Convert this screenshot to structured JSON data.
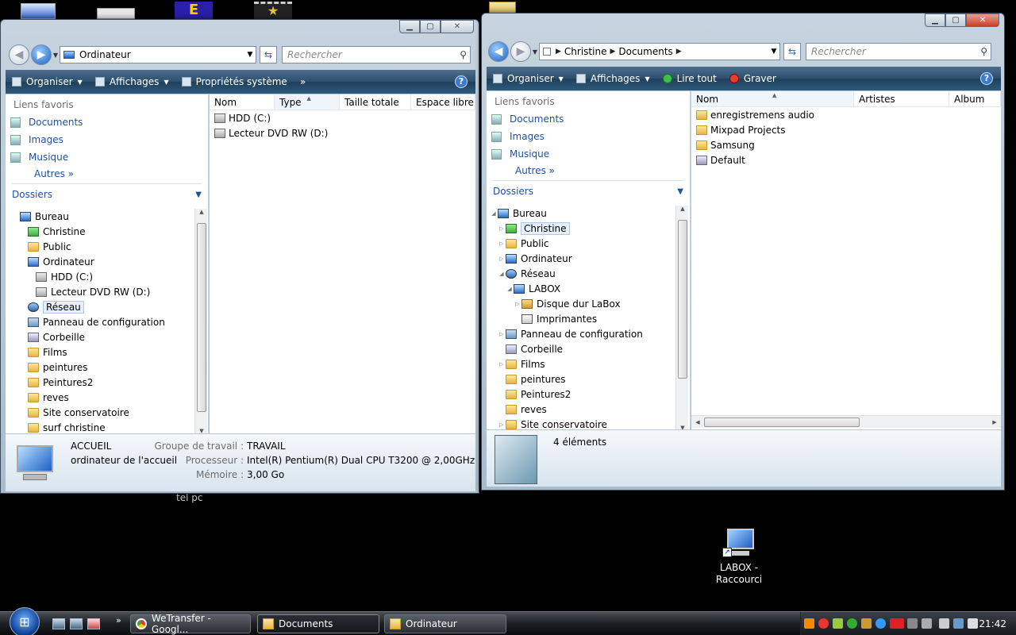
{
  "desktop": {
    "label_tel_pc": "tel pc",
    "labox_shortcut": {
      "line1": "LABOX -",
      "line2": "Raccourci"
    }
  },
  "win1": {
    "address": "Ordinateur",
    "search_placeholder": "Rechercher",
    "toolbar": {
      "organiser": "Organiser",
      "affichages": "Affichages",
      "proprietes": "Propriétés système",
      "more": "»"
    },
    "favorites_header": "Liens favoris",
    "favorites": [
      "Documents",
      "Images",
      "Musique"
    ],
    "autres": "Autres",
    "dossiers": "Dossiers",
    "tree": [
      {
        "label": "Bureau",
        "icon": "pc",
        "indent": 0,
        "exp": ""
      },
      {
        "label": "Christine",
        "icon": "user",
        "indent": 1,
        "exp": ""
      },
      {
        "label": "Public",
        "icon": "folder",
        "indent": 1,
        "exp": ""
      },
      {
        "label": "Ordinateur",
        "icon": "pc",
        "indent": 1,
        "exp": ""
      },
      {
        "label": "HDD (C:)",
        "icon": "drive",
        "indent": 2,
        "exp": ""
      },
      {
        "label": "Lecteur DVD RW (D:)",
        "icon": "drive",
        "indent": 2,
        "exp": ""
      },
      {
        "label": "Réseau",
        "icon": "net",
        "indent": 1,
        "exp": "",
        "selected": true
      },
      {
        "label": "Panneau de configuration",
        "icon": "panel",
        "indent": 1,
        "exp": ""
      },
      {
        "label": "Corbeille",
        "icon": "bin",
        "indent": 1,
        "exp": ""
      },
      {
        "label": "Films",
        "icon": "folder",
        "indent": 1,
        "exp": ""
      },
      {
        "label": "peintures",
        "icon": "folder",
        "indent": 1,
        "exp": ""
      },
      {
        "label": "Peintures2",
        "icon": "folder",
        "indent": 1,
        "exp": ""
      },
      {
        "label": "reves",
        "icon": "folder",
        "indent": 1,
        "exp": ""
      },
      {
        "label": "Site conservatoire",
        "icon": "folder",
        "indent": 1,
        "exp": ""
      },
      {
        "label": "surf christine",
        "icon": "folder",
        "indent": 1,
        "exp": ""
      }
    ],
    "columns": [
      "Nom",
      "Type",
      "Taille totale",
      "Espace libre"
    ],
    "files": [
      {
        "name": "HDD (C:)",
        "icon": "drive"
      },
      {
        "name": "Lecteur DVD RW (D:)",
        "icon": "drive"
      }
    ],
    "details": {
      "name": "ACCUEIL",
      "desc": "ordinateur de l'accueil",
      "workgroup_label": "Groupe de travail :",
      "workgroup": "TRAVAIL",
      "processor_label": "Processeur :",
      "processor": "Intel(R) Pentium(R) Dual  CPU  T3200  @ 2,00GHz",
      "memory_label": "Mémoire :",
      "memory": "3,00 Go"
    }
  },
  "win2": {
    "breadcrumb": [
      "Christine",
      "Documents"
    ],
    "search_placeholder": "Rechercher",
    "toolbar": {
      "organiser": "Organiser",
      "affichages": "Affichages",
      "lire": "Lire tout",
      "graver": "Graver"
    },
    "favorites_header": "Liens favoris",
    "favorites": [
      "Documents",
      "Images",
      "Musique"
    ],
    "autres": "Autres",
    "dossiers": "Dossiers",
    "tree": [
      {
        "label": "Bureau",
        "icon": "pc",
        "indent": 0,
        "exp": "◢"
      },
      {
        "label": "Christine",
        "icon": "user",
        "indent": 1,
        "exp": "▷",
        "selected": true
      },
      {
        "label": "Public",
        "icon": "folder",
        "indent": 1,
        "exp": "▷"
      },
      {
        "label": "Ordinateur",
        "icon": "pc",
        "indent": 1,
        "exp": "▷"
      },
      {
        "label": "Réseau",
        "icon": "net",
        "indent": 1,
        "exp": "◢"
      },
      {
        "label": "LABOX",
        "icon": "pc",
        "indent": 2,
        "exp": "◢"
      },
      {
        "label": "Disque dur LaBox",
        "icon": "netdrive",
        "indent": 3,
        "exp": "▷"
      },
      {
        "label": "Imprimantes",
        "icon": "printer",
        "indent": 3,
        "exp": ""
      },
      {
        "label": "Panneau de configuration",
        "icon": "panel",
        "indent": 1,
        "exp": "▷"
      },
      {
        "label": "Corbeille",
        "icon": "bin",
        "indent": 1,
        "exp": ""
      },
      {
        "label": "Films",
        "icon": "folder",
        "indent": 1,
        "exp": "▷"
      },
      {
        "label": "peintures",
        "icon": "folder",
        "indent": 1,
        "exp": ""
      },
      {
        "label": "Peintures2",
        "icon": "folder",
        "indent": 1,
        "exp": ""
      },
      {
        "label": "reves",
        "icon": "folder",
        "indent": 1,
        "exp": ""
      },
      {
        "label": "Site conservatoire",
        "icon": "folder",
        "indent": 1,
        "exp": "▷"
      }
    ],
    "columns": [
      "Nom",
      "Artistes",
      "Album"
    ],
    "files": [
      {
        "name": "enregistremens audio",
        "icon": "folder"
      },
      {
        "name": "Mixpad Projects",
        "icon": "folder"
      },
      {
        "name": "Samsung",
        "icon": "folder"
      },
      {
        "name": "Default",
        "icon": "bin"
      }
    ],
    "details": {
      "count": "4 éléments"
    }
  },
  "taskbar": {
    "start_glyph": "⊞",
    "more": "»",
    "tasks": [
      {
        "label": "WeTransfer - Googl...",
        "icon": "chrome"
      },
      {
        "label": "Documents",
        "icon": "folder",
        "active": true
      },
      {
        "label": "Ordinateur",
        "icon": "folder"
      }
    ],
    "clock": "21:42"
  }
}
